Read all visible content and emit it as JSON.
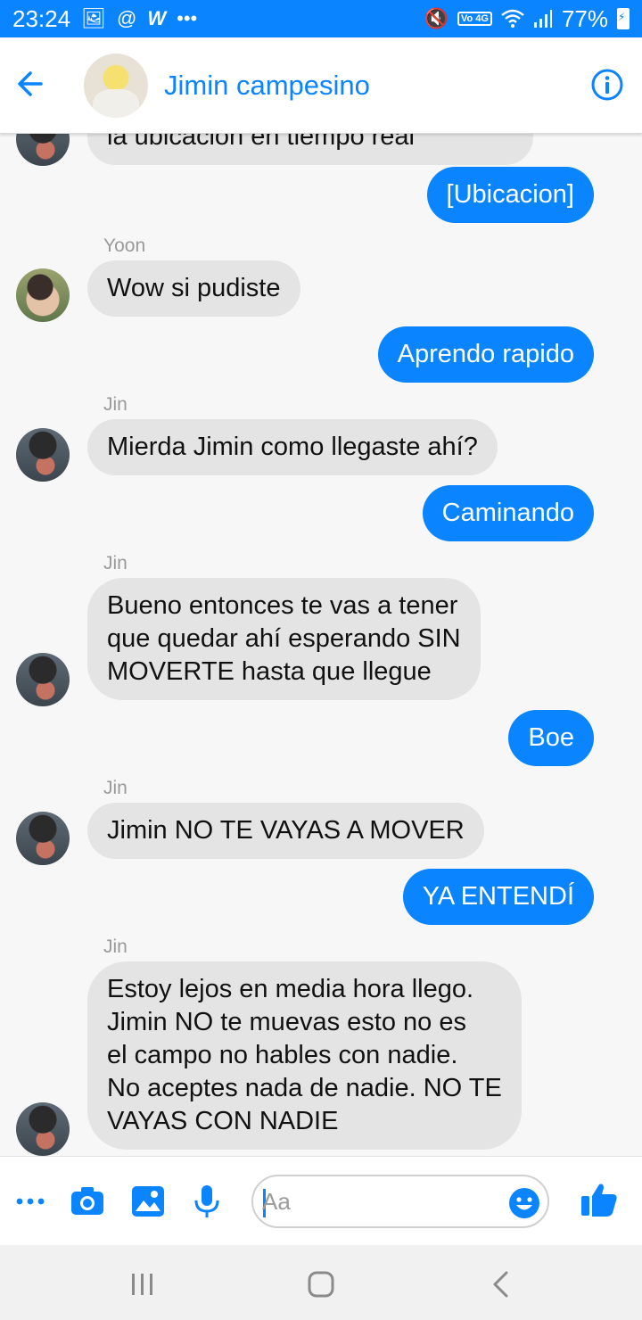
{
  "status_bar": {
    "time": "23:24",
    "battery": "77%",
    "network_badge": "Vo 4G",
    "left_icons": [
      "image-icon",
      "at-icon",
      "w-icon",
      "more-dots-icon"
    ],
    "right_icons": [
      "mute-icon",
      "volte-icon",
      "wifi-icon",
      "signal-icon",
      "battery-icon"
    ]
  },
  "header": {
    "title": "Jimin campesino",
    "accent_color": "#0a84ff"
  },
  "messages": [
    {
      "type": "in",
      "text": "la ubicación en tiempo real"
    },
    {
      "type": "out",
      "text": "[Ubicacion]"
    },
    {
      "type": "in",
      "sender": "Yoon",
      "text": "Wow si pudiste"
    },
    {
      "type": "out",
      "text": "Aprendo rapido"
    },
    {
      "type": "in",
      "sender": "Jin",
      "text": "Mierda Jimin como llegaste ahí?"
    },
    {
      "type": "out",
      "text": "Caminando"
    },
    {
      "type": "in",
      "sender": "Jin",
      "text": "Bueno entonces te vas a tener\nque quedar ahí esperando SIN\nMOVERTE hasta que llegue"
    },
    {
      "type": "out",
      "text": "Boe"
    },
    {
      "type": "in",
      "sender": "Jin",
      "text": "Jimin NO TE VAYAS A MOVER"
    },
    {
      "type": "out",
      "text": "YA ENTENDÍ"
    },
    {
      "type": "in",
      "sender": "Jin",
      "text": "Estoy lejos en media hora llego.\nJimin NO te muevas esto no es\nel campo no hables con nadie.\nNo aceptes nada de nadie. NO TE\nVAYAS CON NADIE"
    }
  ],
  "composer": {
    "placeholder": "Aa",
    "value": ""
  },
  "colors": {
    "outgoing_bubble": "#0a84ff",
    "incoming_bubble": "#e4e4e4",
    "status_bar": "#0a84ff"
  }
}
